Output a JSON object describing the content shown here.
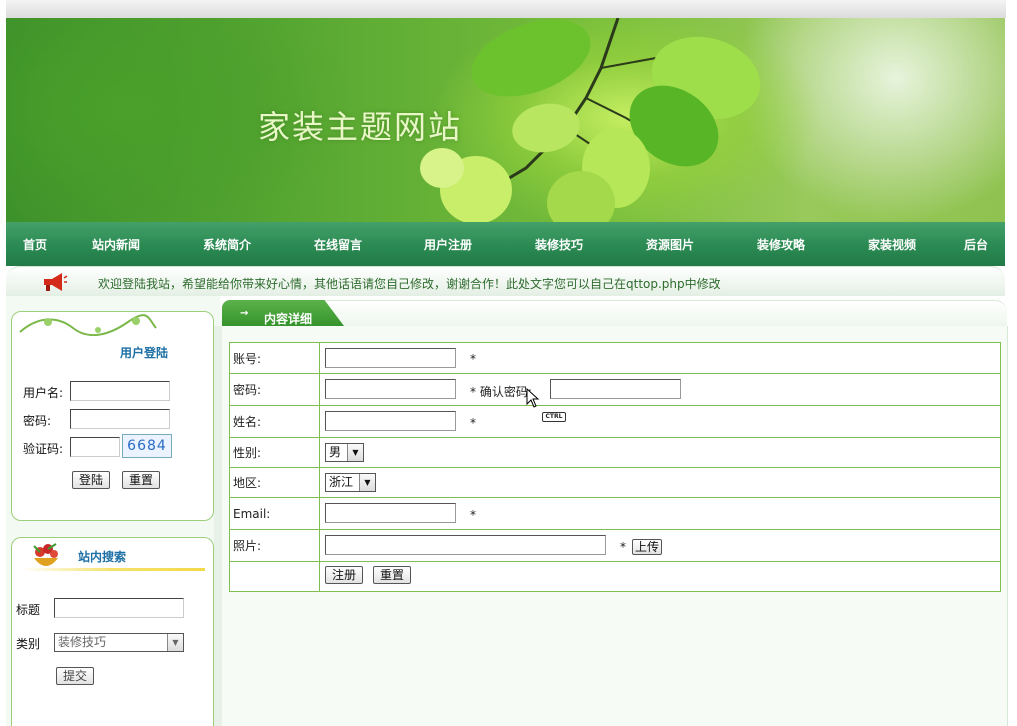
{
  "site": {
    "title": "家装主题网站"
  },
  "nav": {
    "items": [
      "首页",
      "站内新闻",
      "系统简介",
      "在线留言",
      "用户注册",
      "装修技巧",
      "资源图片",
      "装修攻略",
      "家装视频",
      "后台"
    ]
  },
  "marquee": {
    "text": "欢迎登陆我站，希望能给你带来好心情，其他话语请您自己修改，谢谢合作！此处文字您可以自己在qttop.php中修改"
  },
  "login": {
    "title": "用户登陆",
    "username_label": "用户名:",
    "password_label": "密码:",
    "captcha_label": "验证码:",
    "captcha_code": "6684",
    "login_button": "登陆",
    "reset_button": "重置"
  },
  "search": {
    "title": "站内搜索",
    "title_label": "标题",
    "category_label": "类别",
    "category_selected": "装修技巧",
    "submit_button": "提交"
  },
  "content": {
    "tab_label": "内容详细",
    "tab_arrow": "→",
    "form": {
      "account_label": "账号:",
      "password_label": "密码:",
      "confirm_password_label": "* 确认密码:",
      "name_label": "姓名:",
      "gender_label": "性别:",
      "gender_selected": "男",
      "region_label": "地区:",
      "region_selected": "浙江",
      "email_label": "Email:",
      "photo_label": "照片:",
      "required_mark": "*",
      "upload_button": "上传",
      "register_button": "注册",
      "reset_button": "重置"
    }
  },
  "overlay": {
    "ctrl_badge": "CTRL"
  },
  "colors": {
    "nav_green": "#2a8a52",
    "border_green": "#7fbf4f",
    "panel_title_blue": "#1d6fa5"
  }
}
